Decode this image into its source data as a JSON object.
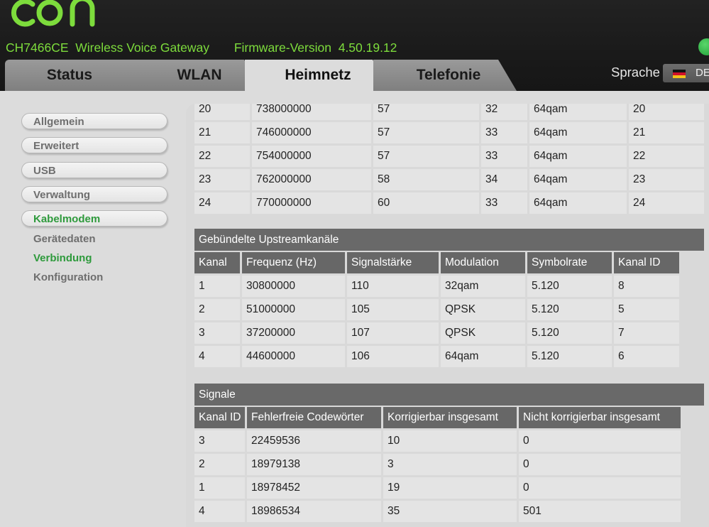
{
  "header": {
    "device_model": "CH7466CE",
    "device_name": "Wireless Voice Gateway",
    "firmware_label": "Firmware-Version",
    "firmware_version": "4.50.19.12",
    "brand_color": "#7ddc3c"
  },
  "tabs": [
    {
      "label": "Status",
      "active": false
    },
    {
      "label": "WLAN",
      "active": false
    },
    {
      "label": "Heimnetz",
      "active": true
    },
    {
      "label": "Telefonie",
      "active": false
    }
  ],
  "language": {
    "label": "Sprache",
    "value": "DE",
    "flag": "german-flag-icon"
  },
  "sidebar": {
    "items": [
      {
        "label": "Allgemein",
        "active": false
      },
      {
        "label": "Erweitert",
        "active": false
      },
      {
        "label": "USB",
        "active": false
      },
      {
        "label": "Verwaltung",
        "active": false
      },
      {
        "label": "Kabelmodem",
        "active": true
      }
    ],
    "subitems": [
      {
        "label": "Gerätedaten",
        "active": false
      },
      {
        "label": "Verbindung",
        "active": true
      },
      {
        "label": "Konfiguration",
        "active": false
      }
    ],
    "active_color": "#2e9a3c"
  },
  "downstream_rows": [
    [
      "20",
      "738000000",
      "57",
      "32",
      "64qam",
      "20"
    ],
    [
      "21",
      "746000000",
      "57",
      "33",
      "64qam",
      "21"
    ],
    [
      "22",
      "754000000",
      "57",
      "33",
      "64qam",
      "22"
    ],
    [
      "23",
      "762000000",
      "58",
      "34",
      "64qam",
      "23"
    ],
    [
      "24",
      "770000000",
      "60",
      "33",
      "64qam",
      "24"
    ]
  ],
  "upstream": {
    "title": "Gebündelte Upstreamkanäle",
    "headers": [
      "Kanal",
      "Frequenz (Hz)",
      "Signalstärke",
      "Modulation",
      "Symbolrate",
      "Kanal ID"
    ],
    "rows": [
      [
        "1",
        "30800000",
        "110",
        "32qam",
        "5.120",
        "8"
      ],
      [
        "2",
        "51000000",
        "105",
        "QPSK",
        "5.120",
        "5"
      ],
      [
        "3",
        "37200000",
        "107",
        "QPSK",
        "5.120",
        "7"
      ],
      [
        "4",
        "44600000",
        "106",
        "64qam",
        "5.120",
        "6"
      ]
    ]
  },
  "signals": {
    "title": "Signale",
    "headers": [
      "Kanal ID",
      "Fehlerfreie Codewörter",
      "Korrigierbar insgesamt",
      "Nicht korrigierbar insgesamt"
    ],
    "rows": [
      [
        "3",
        "22459536",
        "10",
        "0"
      ],
      [
        "2",
        "18979138",
        "3",
        "0"
      ],
      [
        "1",
        "18978452",
        "19",
        "0"
      ],
      [
        "4",
        "18986534",
        "35",
        "501"
      ]
    ]
  }
}
